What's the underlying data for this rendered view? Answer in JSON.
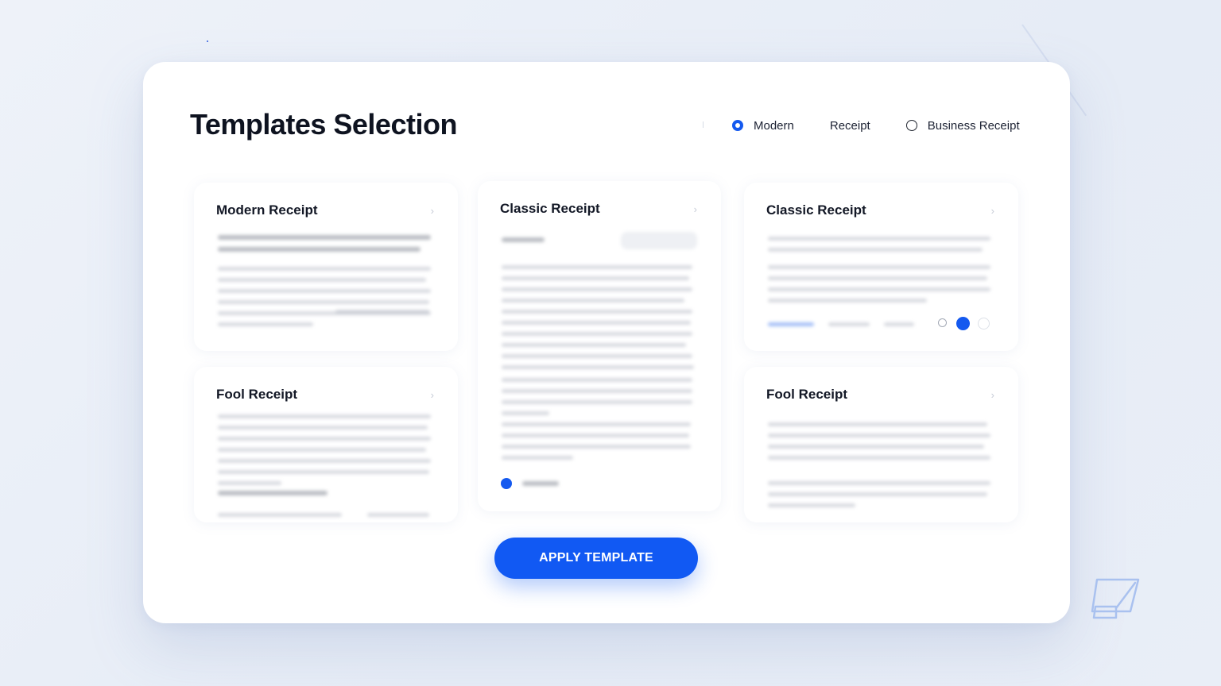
{
  "page": {
    "title": "Templates Selection"
  },
  "filter": {
    "options": [
      {
        "label": "Modern",
        "selected": true
      },
      {
        "label": "Receipt",
        "selected": false
      },
      {
        "label": "Business Receipt",
        "selected": false
      }
    ]
  },
  "cards": [
    {
      "title": "Modern Receipt"
    },
    {
      "title": "Classic Receipt"
    },
    {
      "title": "Classic Receipt"
    },
    {
      "title": "Fool Receipt"
    },
    {
      "title": "Fool Receipt"
    }
  ],
  "actions": {
    "apply_label": "APPLY TEMPLATE"
  },
  "colors": {
    "accent": "#1159f3",
    "background": "#eaeff7",
    "panel": "#ffffff"
  },
  "icons": {
    "chevron": "chevron-right-icon",
    "corner": "edit-window-icon"
  }
}
